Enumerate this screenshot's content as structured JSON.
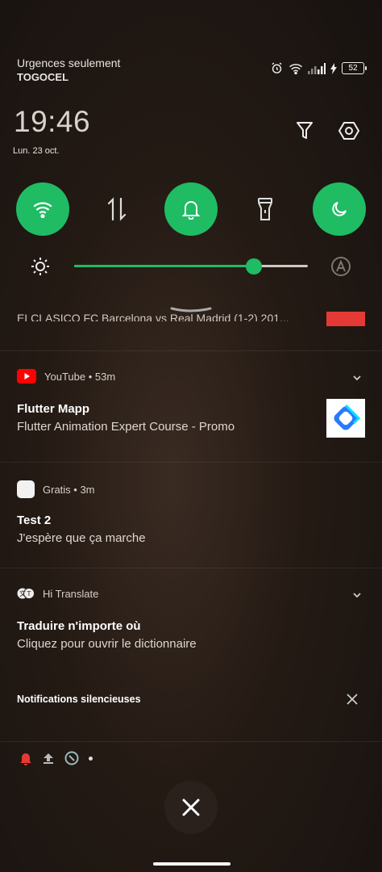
{
  "status_bar": {
    "carrier_line1": "Urgences seulement",
    "carrier_line2": "TOGOCEL",
    "battery": "52",
    "icons": [
      "alarm-icon",
      "wifi-icon",
      "signal-icon",
      "charging-icon",
      "battery-icon"
    ]
  },
  "header": {
    "time": "19:46",
    "date": "Lun. 23 oct.",
    "filter_icon": "filter-icon",
    "settings_icon": "settings-icon"
  },
  "quick_settings": [
    {
      "name": "wifi",
      "icon": "wifi-icon",
      "active": true
    },
    {
      "name": "mobile-data",
      "icon": "data-arrows-icon",
      "active": false
    },
    {
      "name": "sound",
      "icon": "bell-icon",
      "active": true
    },
    {
      "name": "flashlight",
      "icon": "flashlight-icon",
      "active": false
    },
    {
      "name": "dark-mode",
      "icon": "moon-icon",
      "active": true
    }
  ],
  "brightness": {
    "level": 0.77,
    "auto_icon": "auto-brightness-icon"
  },
  "truncated_notification": {
    "text": "ELCLASICO FC Barcelona vs Real Madrid (1-2) 201..."
  },
  "notifications": [
    {
      "app": "YouTube",
      "time": "53m",
      "title": "Flutter Mapp",
      "body": "Flutter Animation Expert Course - Promo"
    },
    {
      "app": "Gratis",
      "time": "3m",
      "title": "Test 2",
      "body": "J'espère que ça marche"
    },
    {
      "app": "Hi Translate",
      "time": "",
      "title": "Traduire n'importe où",
      "body": "Cliquez pour ouvrir le dictionnaire"
    }
  ],
  "silent": {
    "label": "Notifications silencieuses"
  },
  "colors": {
    "accent": "#1fbc63",
    "youtube": "#ff0000"
  }
}
